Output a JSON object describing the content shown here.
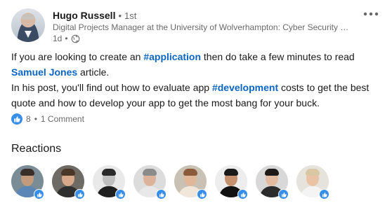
{
  "post": {
    "author": {
      "name": "Hugo Russell",
      "separator": "•",
      "degree": "1st",
      "headline": "Digital Projects Manager at the University of Wolverhampton: Cyber Security …",
      "time": "1d",
      "time_separator": "•",
      "visibility_icon": "globe-icon"
    },
    "menu_icon": "ellipsis-icon",
    "body": {
      "line1_pre": "If you are looking to create an ",
      "hashtag1": "#application",
      "line1_post": " then do take a few minutes to read",
      "mention": "Samuel Jones",
      "line2_post": " article.",
      "line3_pre": "In his post, you'll find out how to evaluate app ",
      "hashtag2": "#development",
      "line3_post": " costs to get the best quote and how to develop your app to get the most bang for your buck."
    },
    "social": {
      "reaction_icon": "like-icon",
      "reaction_count": "8",
      "separator": "•",
      "comments": "1 Comment"
    }
  },
  "reactions": {
    "title": "Reactions",
    "people": [
      {
        "label": "reactor-1",
        "bg": "#7a8c96",
        "skin": "#c49a7c",
        "shirt": "#5b86b5",
        "hair": "#3a2f28"
      },
      {
        "label": "reactor-2",
        "bg": "#6e6a64",
        "skin": "#d7a98a",
        "shirt": "#2f2f2f",
        "hair": "#4a3728"
      },
      {
        "label": "reactor-3",
        "bg": "#e9e9e9",
        "skin": "#bfbfbf",
        "shirt": "#1f1f1f",
        "hair": "#2a2a2a"
      },
      {
        "label": "reactor-4",
        "bg": "#dcdcdc",
        "skin": "#dcb39a",
        "shirt": "#e8e8e8",
        "hair": "#8b8b8b"
      },
      {
        "label": "reactor-5",
        "bg": "#c9c1b4",
        "skin": "#e1b79a",
        "shirt": "#f0e6da",
        "hair": "#8a5a3a"
      },
      {
        "label": "reactor-6",
        "bg": "#ededed",
        "skin": "#c4906e",
        "shirt": "#111111",
        "hair": "#1a1a1a"
      },
      {
        "label": "reactor-7",
        "bg": "#d8d8d8",
        "skin": "#e2bba0",
        "shirt": "#2b2b2b",
        "hair": "#1e1a18"
      },
      {
        "label": "reactor-8",
        "bg": "#e6e2dc",
        "skin": "#eac3a6",
        "shirt": "#f4f4f4",
        "hair": "#d9c6a3"
      }
    ]
  },
  "colors": {
    "link": "#0a66c2",
    "like_blue": "#378fe9",
    "text_secondary": "#666666"
  }
}
